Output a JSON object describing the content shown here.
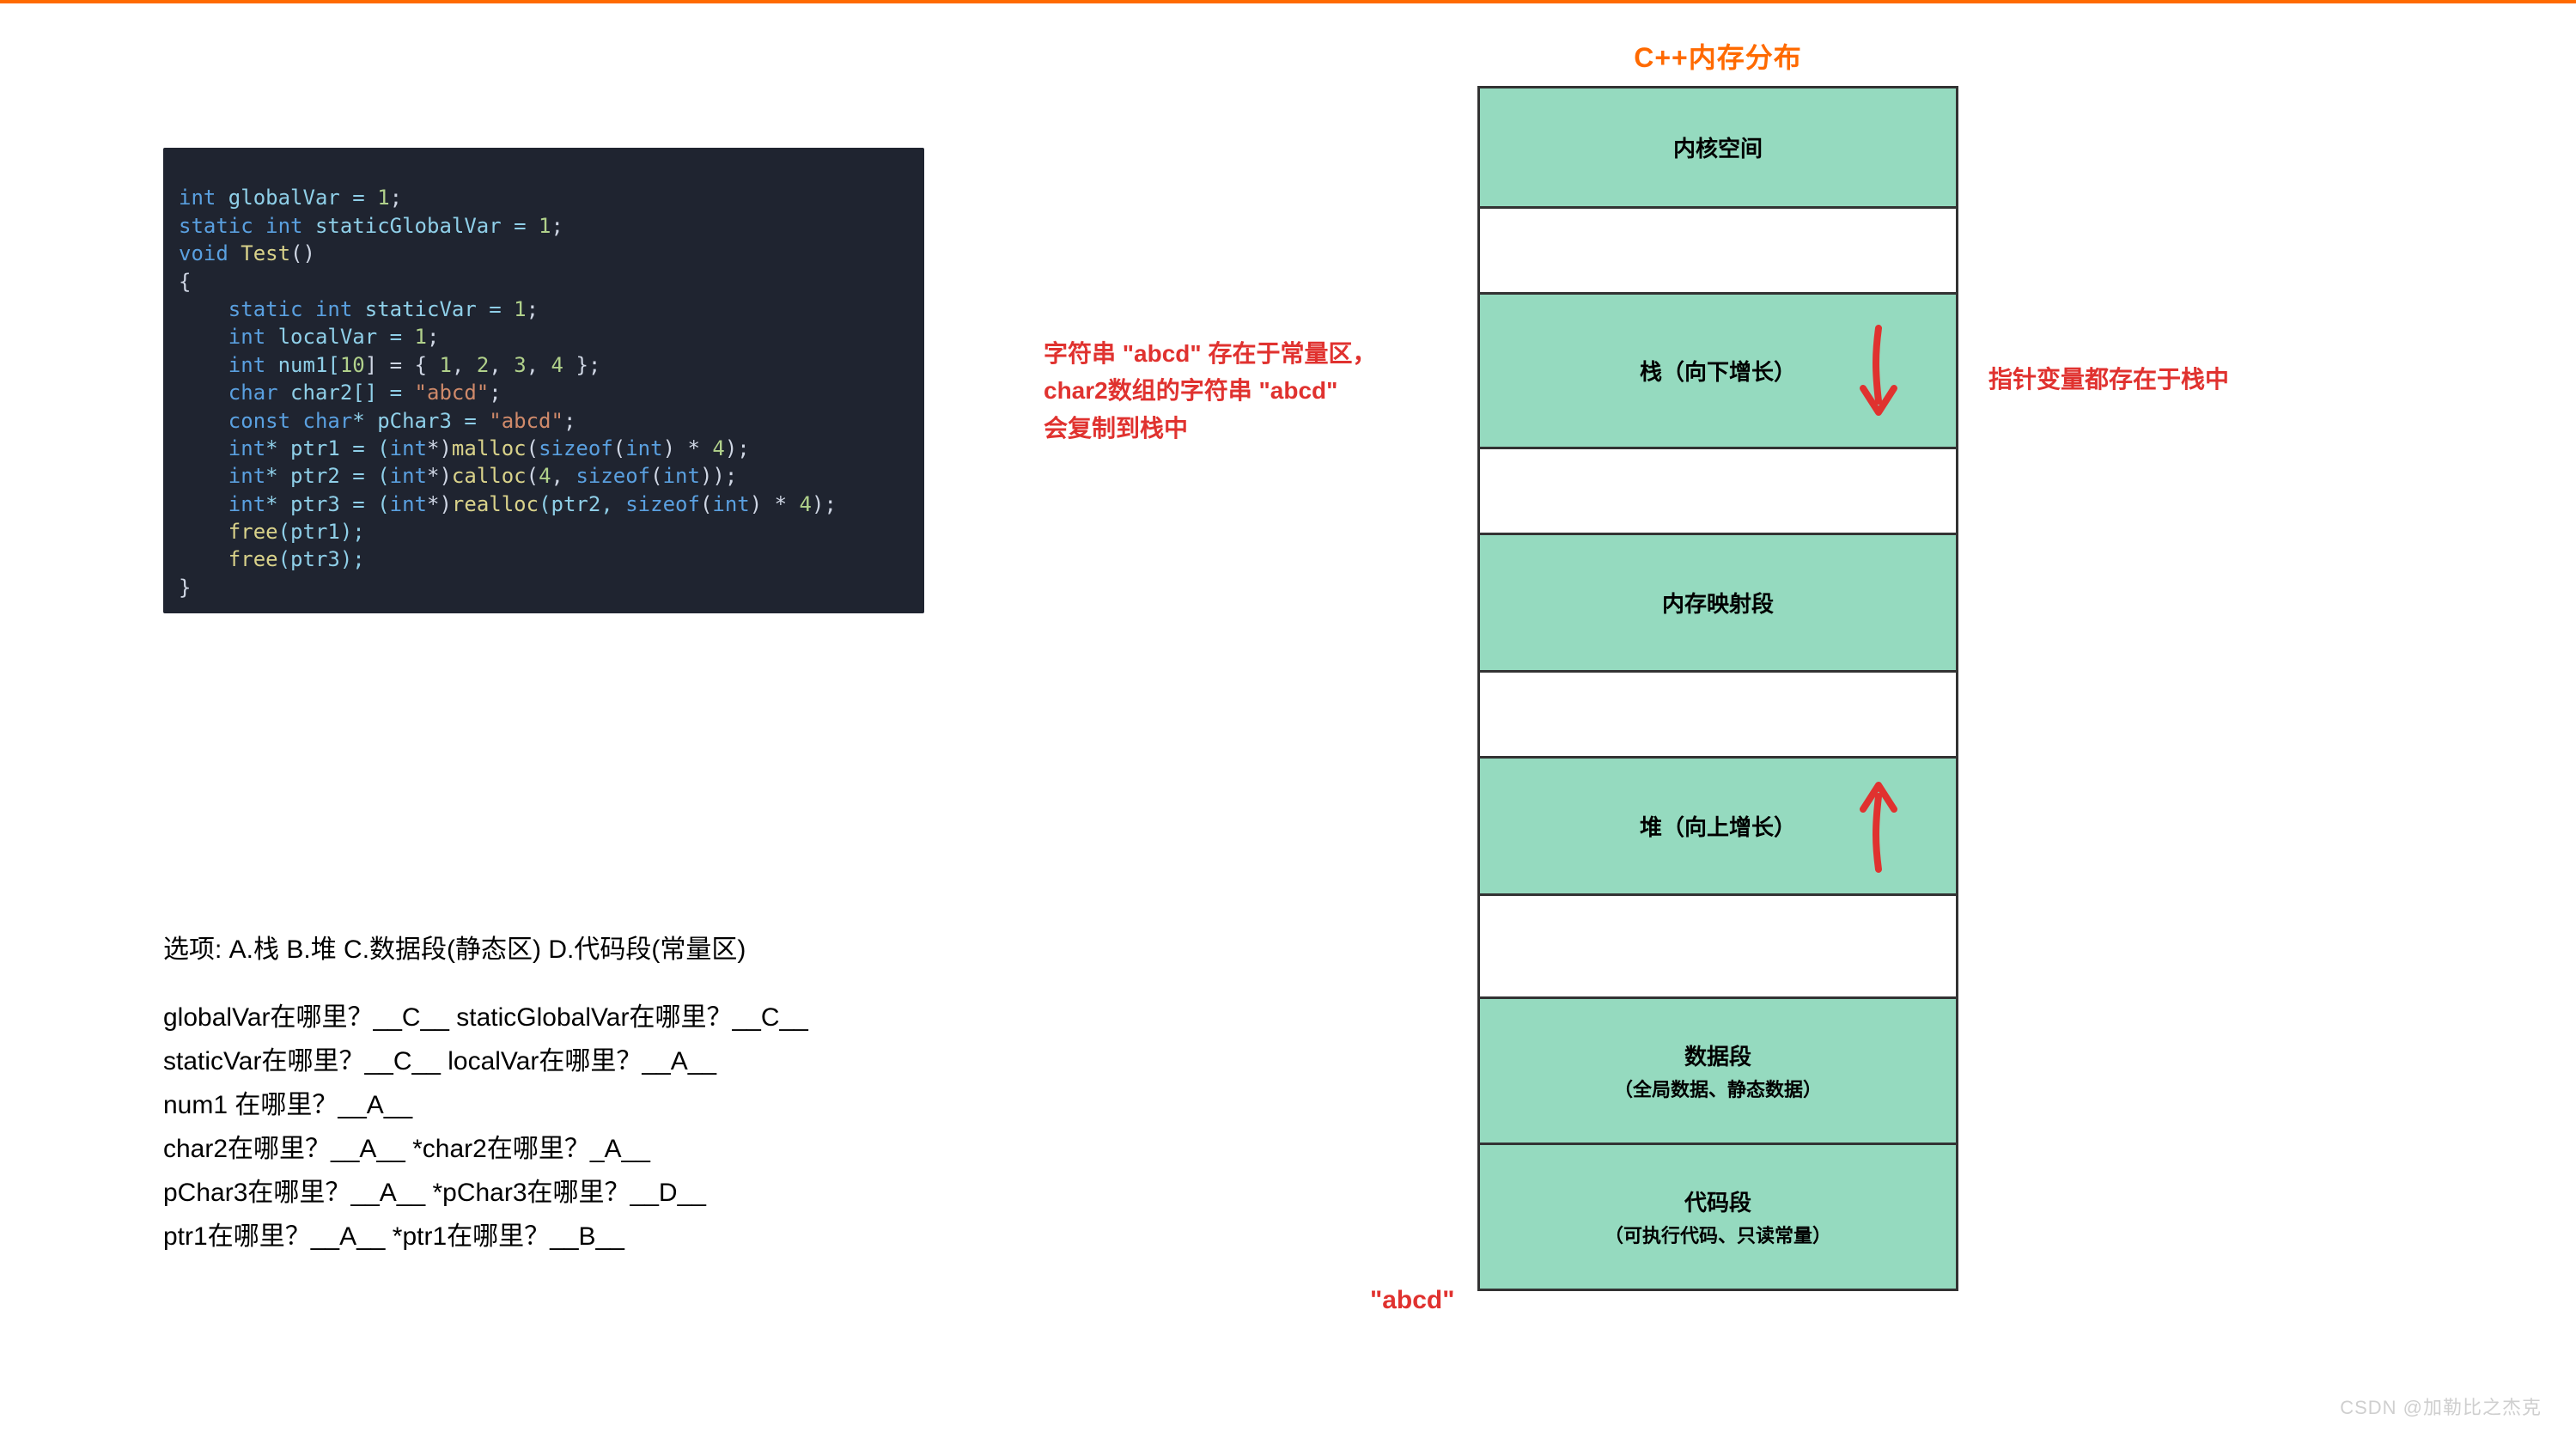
{
  "title": "C++内存分布",
  "code": {
    "l1": {
      "a": "int",
      "b": " globalVar = ",
      "c": "1",
      "d": ";"
    },
    "l2": {
      "a": "static int",
      "b": " staticGlobalVar = ",
      "c": "1",
      "d": ";"
    },
    "l3": {
      "a": "void",
      "b": " ",
      "c": "Test",
      "d": "()"
    },
    "l4": {
      "a": "{"
    },
    "l5": {
      "a": "    static int",
      "b": " staticVar = ",
      "c": "1",
      "d": ";"
    },
    "l6": {
      "a": "    int",
      "b": " localVar = ",
      "c": "1",
      "d": ";"
    },
    "l7": {
      "a": "    int",
      "b": " num1[",
      "c": "10",
      "d": "] = { ",
      "e": "1",
      "f": ", ",
      "g": "2",
      "h": ", ",
      "i": "3",
      "j": ", ",
      "k": "4",
      "l": " };"
    },
    "l8": {
      "a": "    char",
      "b": " char2[] = ",
      "c": "\"abcd\"",
      "d": ";"
    },
    "l9": {
      "a": "    const char",
      "b": "* pChar3 = ",
      "c": "\"abcd\"",
      "d": ";"
    },
    "l10": {
      "a": "    int",
      "b": "* ptr1 = (",
      "c": "int",
      "d": "*)",
      "e": "malloc",
      "f": "(",
      "g": "sizeof",
      "h": "(",
      "i": "int",
      "j": ") * ",
      "k": "4",
      "l": ");"
    },
    "l11": {
      "a": "    int",
      "b": "* ptr2 = (",
      "c": "int",
      "d": "*)",
      "e": "calloc",
      "f": "(",
      "g": "4",
      "h": ", ",
      "i": "sizeof",
      "j": "(",
      "k": "int",
      "l": "));"
    },
    "l12": {
      "a": "    int",
      "b": "* ptr3 = (",
      "c": "int",
      "d": "*)",
      "e": "realloc",
      "f": "(ptr2, ",
      "g": "sizeof",
      "h": "(",
      "i": "int",
      "j": ") * ",
      "k": "4",
      "l": ");"
    },
    "l13": {
      "a": "    ",
      "b": "free",
      "c": "(ptr1);"
    },
    "l14": {
      "a": "    ",
      "b": "free",
      "c": "(ptr3);"
    },
    "l15": {
      "a": "}"
    }
  },
  "annotations": {
    "left_line1": "字符串 \"abcd\" 存在于常量区，",
    "left_line2": "char2数组的字符串 \"abcd\"",
    "left_line3": "会复制到栈中",
    "right": "指针变量都存在于栈中",
    "abcd": "\"abcd\""
  },
  "questions": {
    "options": "选项: A.栈 B.堆 C.数据段(静态区) D.代码段(常量区)",
    "q1": "globalVar在哪里？__C__ staticGlobalVar在哪里？__C__",
    "q2": "staticVar在哪里？__C__ localVar在哪里？__A__",
    "q3": "num1 在哪里？__A__",
    "q4": "char2在哪里？__A__ *char2在哪里？_A__",
    "q5": "pChar3在哪里？__A__ *pChar3在哪里？__D__",
    "q6": "ptr1在哪里？__A__ *ptr1在哪里？__B__"
  },
  "memory": {
    "r0": "内核空间",
    "r2": "栈（向下增长）",
    "r4": "内存映射段",
    "r6": "堆（向上增长）",
    "r8_main": "数据段",
    "r8_sub": "（全局数据、静态数据）",
    "r9_main": "代码段",
    "r9_sub": "（可执行代码、只读常量）"
  },
  "colors": {
    "accent": "#ff6a00",
    "annotation": "#e0322f",
    "row_green": "#95dabf",
    "code_bg": "#1f2430"
  },
  "watermark": "CSDN @加勒比之杰克"
}
